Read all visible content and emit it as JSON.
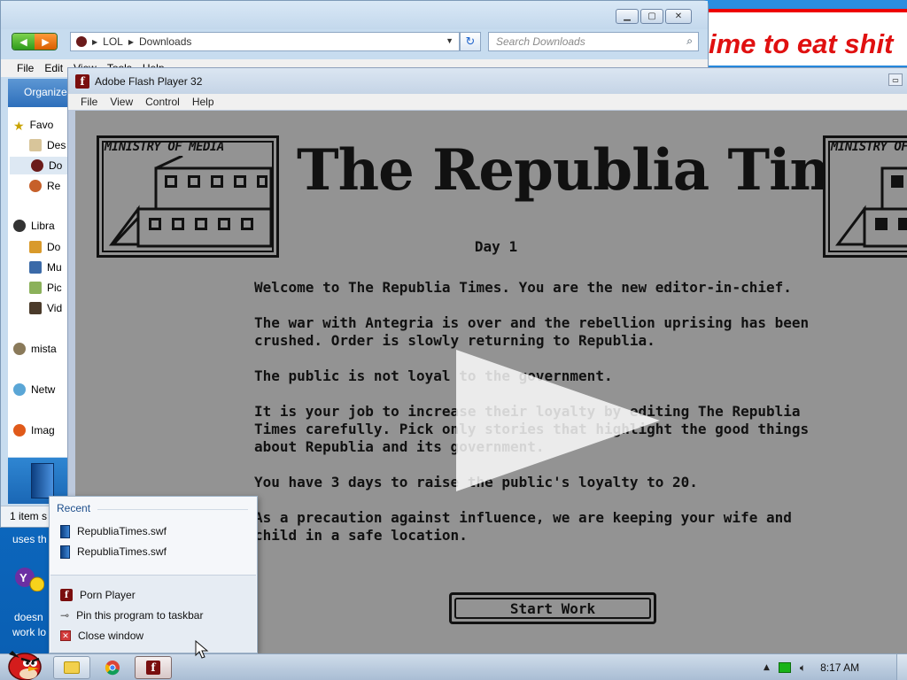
{
  "banner": {
    "text": "ime to eat shit"
  },
  "explorer": {
    "address_segments": [
      "LOL",
      "Downloads"
    ],
    "search_placeholder": "Search Downloads",
    "menu": [
      "File",
      "Edit",
      "View",
      "Tools",
      "Help"
    ],
    "organize_label": "Organize",
    "nav_items": [
      {
        "label": "Favo",
        "icon": "star-icon"
      },
      {
        "label": "Des",
        "icon": "desktop-folder-icon"
      },
      {
        "label": "Do",
        "icon": "downloads-folder-icon"
      },
      {
        "label": "Re",
        "icon": "recent-places-icon"
      },
      {
        "label": "Libra",
        "icon": "libraries-icon"
      },
      {
        "label": "Do",
        "icon": "documents-icon"
      },
      {
        "label": "Mu",
        "icon": "music-icon"
      },
      {
        "label": "Pic",
        "icon": "pictures-icon"
      },
      {
        "label": "Vid",
        "icon": "videos-icon"
      },
      {
        "label": "mista",
        "icon": "user-icon"
      },
      {
        "label": "Netw",
        "icon": "network-icon"
      },
      {
        "label": "Imag",
        "icon": "image-app-icon"
      }
    ],
    "status_text": "1 item s"
  },
  "desktop_snippets": {
    "uses": "uses th",
    "doesn": "doesn",
    "work": "work lo"
  },
  "flash": {
    "title": "Adobe Flash Player 32",
    "menu": [
      "File",
      "View",
      "Control",
      "Help"
    ],
    "ministry_label": "MINISTRY OF MEDIA",
    "masthead": "The Republia Times",
    "day": "Day 1",
    "story": [
      "Welcome to The Republia Times. You are the new editor-in-chief.",
      "The war with Antegria is over and the rebellion uprising has been\ncrushed. Order is slowly returning to Republia.",
      "The public is not loyal to the government.",
      "It is your job to increase their loyalty by editing The Republia\nTimes carefully. Pick only stories that highlight the good things\nabout Republia and its government.",
      "You have 3 days to raise the public's loyalty to 20.",
      "As a precaution against influence, we are keeping your wife and\nchild in a safe location."
    ],
    "start_button": "Start Work"
  },
  "jumplist": {
    "recent_header": "Recent",
    "recent_items": [
      "RepubliaTimes.swf",
      "RepubliaTimes.swf"
    ],
    "tasks": [
      {
        "label": "Porn Player",
        "icon": "flash-player-icon"
      },
      {
        "label": "Pin this program to taskbar",
        "icon": "pin-icon"
      },
      {
        "label": "Close window",
        "icon": "close-window-icon"
      }
    ]
  },
  "taskbar": {
    "time": "8:17 AM"
  },
  "colors": {
    "banner_red": "#e01010",
    "stage_gray": "#939393",
    "desktop_blue": "#1d7fd6"
  }
}
